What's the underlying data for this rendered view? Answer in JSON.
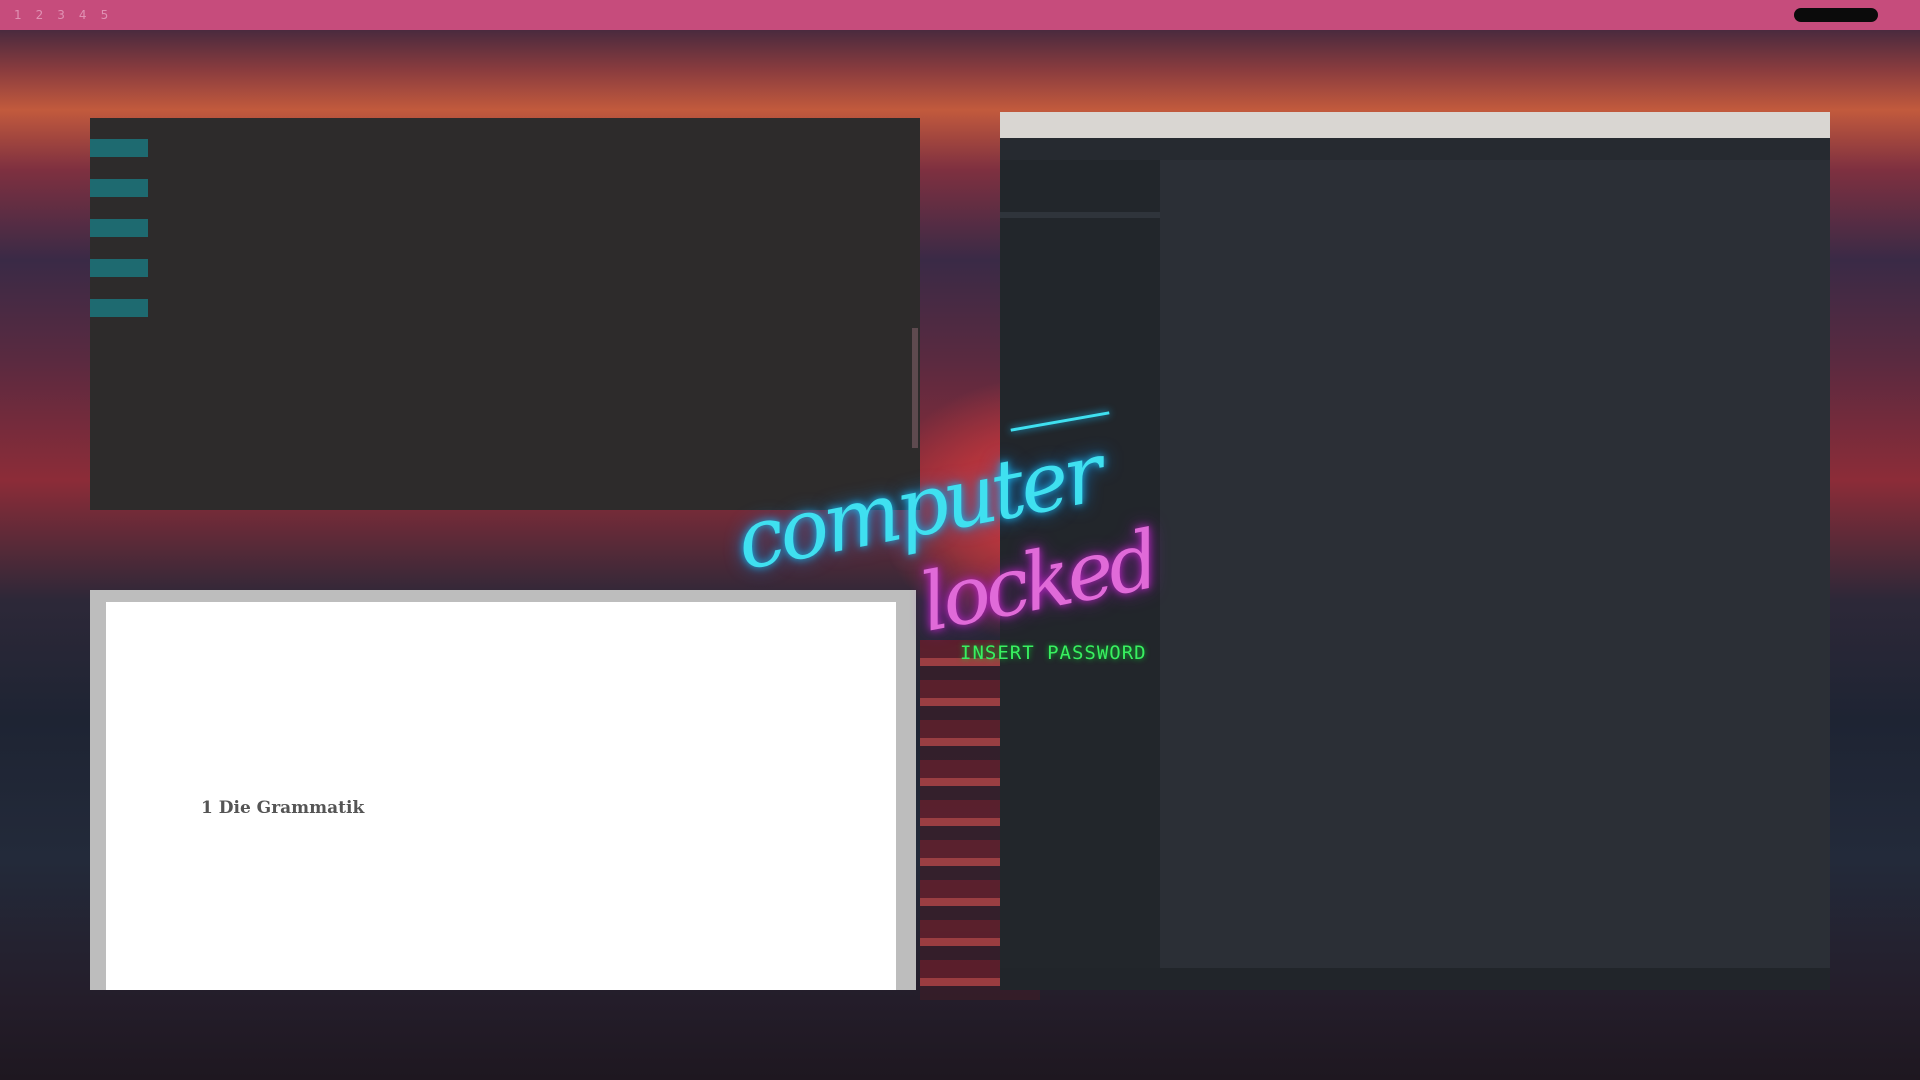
{
  "topbar": {
    "workspaces": [
      "1",
      "2",
      "3",
      "4",
      "5"
    ],
    "status_items": [
      "",
      "",
      "",
      "",
      "",
      ""
    ]
  },
  "terminal": {
    "title": "",
    "rows": [
      {
        "kind": "hl",
        "text": ""
      },
      {
        "kind": "dim",
        "text": ""
      },
      {
        "kind": "hl",
        "text": ""
      },
      {
        "kind": "dim",
        "text": ""
      },
      {
        "kind": "hl",
        "text": ""
      },
      {
        "kind": "dim",
        "text": ""
      },
      {
        "kind": "hl",
        "text": ""
      },
      {
        "kind": "dim",
        "text": ""
      },
      {
        "kind": "hl",
        "text": ""
      },
      {
        "kind": "dim",
        "text": ""
      }
    ]
  },
  "pdf": {
    "header_lines": [
      "",
      "",
      ""
    ],
    "date": "",
    "section_title": "1 Die Grammatik",
    "subsection": "",
    "paragraphs": [
      "",
      "",
      ""
    ]
  },
  "editor": {
    "title": "",
    "tabs": [
      "",
      "",
      "",
      ""
    ],
    "sidebar_folder": "",
    "sidebar_files": [
      "",
      "",
      "",
      "",
      "",
      "",
      "",
      "",
      ""
    ],
    "status_left": "",
    "status_right": ""
  },
  "lock": {
    "title_line1": "computer",
    "title_line2": "locked",
    "prompt": "INSERT PASSWORD"
  },
  "signature": "",
  "colors": {
    "topbar": "#c64c7c",
    "lock_cyan": "#3fe0f0",
    "lock_magenta": "#e06ad8",
    "prompt_green": "#38f060",
    "terminal_bg": "#2d2b2b",
    "editor_bg": "#2b2f36"
  }
}
